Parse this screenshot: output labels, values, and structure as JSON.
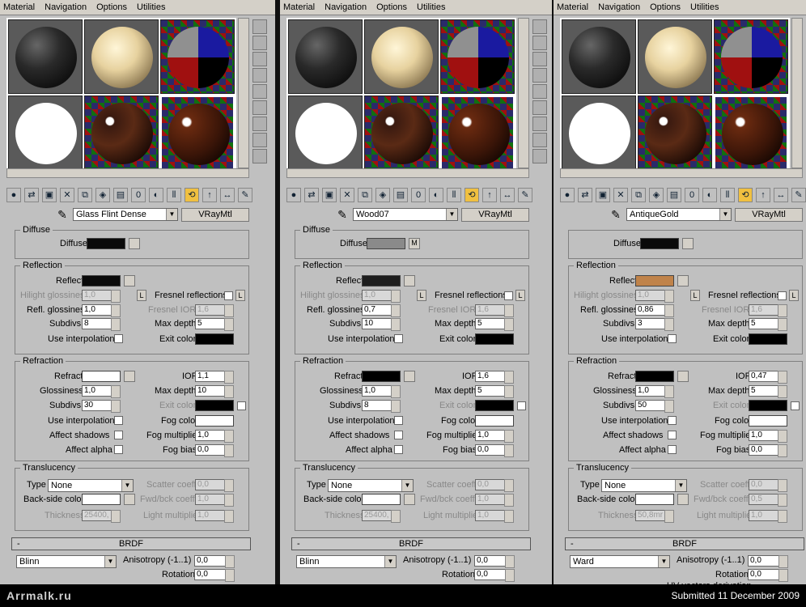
{
  "menu": [
    "Material",
    "Navigation",
    "Options",
    "Utilities"
  ],
  "sidebar_icons": [
    "sphere-icon",
    "backlight-icon",
    "checker-icon",
    "box-icon",
    "colorcheck-icon",
    "vidcolor-icon",
    "options-icon",
    "selectbymat-icon",
    "navigator-icon"
  ],
  "panels": [
    {
      "material_name": "Glass Flint Dense",
      "material_type": "VRayMtl",
      "diffuse": {
        "group": "Diffuse",
        "label": "Diffuse",
        "color": "#0a0a0a",
        "map_btn": ""
      },
      "reflection": {
        "group": "Reflection",
        "reflect_label": "Reflect",
        "reflect_color": "#0a0a0a",
        "hilight_label": "Hilight glossiness",
        "hilight": "1,0",
        "refl_gloss_label": "Refl. glossiness",
        "refl_gloss": "1,0",
        "subdivs_label": "Subdivs",
        "subdivs": "8",
        "use_interp": "Use interpolation",
        "fresnel_label": "Fresnel reflections",
        "fresnel_ior_label": "Fresnel IOR",
        "fresnel_ior": "1,6",
        "max_depth_label": "Max depth",
        "max_depth": "5",
        "exit_label": "Exit color",
        "exit_color": "#000000",
        "lock": "L"
      },
      "refraction": {
        "group": "Refraction",
        "refract_label": "Refract",
        "refract_color": "#ffffff",
        "gloss_label": "Glossiness",
        "gloss": "1,0",
        "subdivs_label": "Subdivs",
        "subdivs": "30",
        "use_interp": "Use interpolation",
        "affect_shadows": "Affect shadows",
        "affect_alpha": "Affect alpha",
        "ior_label": "IOR",
        "ior": "1,1",
        "max_depth_label": "Max depth",
        "max_depth": "10",
        "exit_label": "Exit color",
        "exit_color": "#000000",
        "fog_color_label": "Fog color",
        "fog_color": "#ffffff",
        "fog_mult_label": "Fog multiplier",
        "fog_mult": "1,0",
        "fog_bias_label": "Fog bias",
        "fog_bias": "0,0"
      },
      "translucency": {
        "group": "Translucency",
        "type_label": "Type",
        "type": "None",
        "back_label": "Back-side color",
        "back_color": "#ffffff",
        "thick_label": "Thickness",
        "thickness": "25400,",
        "scatter_label": "Scatter coeff",
        "scatter": "0,0",
        "fwd_label": "Fwd/bck coeff",
        "fwd": "1,0",
        "light_label": "Light multiplier",
        "light": "1,0"
      },
      "brdf": {
        "title": "BRDF",
        "minus": "-",
        "type": "Blinn",
        "aniso_label": "Anisotropy (-1..1)",
        "aniso": "0,0",
        "rot_label": "Rotation",
        "rot": "0,0"
      }
    },
    {
      "material_name": "Wood07",
      "material_type": "VRayMtl",
      "diffuse": {
        "group": "Diffuse",
        "label": "Diffuse",
        "color": "#8a8a8a",
        "map_btn": "M"
      },
      "reflection": {
        "group": "Reflection",
        "reflect_label": "Reflect",
        "reflect_color": "#1e1e1e",
        "hilight_label": "Hilight glossiness",
        "hilight": "1,0",
        "refl_gloss_label": "Refl. glossiness",
        "refl_gloss": "0,7",
        "subdivs_label": "Subdivs",
        "subdivs": "10",
        "use_interp": "Use interpolation",
        "fresnel_label": "Fresnel reflections",
        "fresnel_ior_label": "Fresnel IOR",
        "fresnel_ior": "1,6",
        "max_depth_label": "Max depth",
        "max_depth": "5",
        "exit_label": "Exit color",
        "exit_color": "#000000",
        "lock": "L"
      },
      "refraction": {
        "group": "Refraction",
        "refract_label": "Refract",
        "refract_color": "#000000",
        "gloss_label": "Glossiness",
        "gloss": "1,0",
        "subdivs_label": "Subdivs",
        "subdivs": "8",
        "use_interp": "Use interpolation",
        "affect_shadows": "Affect shadows",
        "affect_alpha": "Affect alpha",
        "ior_label": "IOR",
        "ior": "1,6",
        "max_depth_label": "Max depth",
        "max_depth": "5",
        "exit_label": "Exit color",
        "exit_color": "#000000",
        "fog_color_label": "Fog color",
        "fog_color": "#ffffff",
        "fog_mult_label": "Fog multiplier",
        "fog_mult": "1,0",
        "fog_bias_label": "Fog bias",
        "fog_bias": "0,0"
      },
      "translucency": {
        "group": "Translucency",
        "type_label": "Type",
        "type": "None",
        "back_label": "Back-side color",
        "back_color": "#ffffff",
        "thick_label": "Thickness",
        "thickness": "25400,",
        "scatter_label": "Scatter coeff",
        "scatter": "0,0",
        "fwd_label": "Fwd/bck coeff",
        "fwd": "1,0",
        "light_label": "Light multiplier",
        "light": "1,0"
      },
      "brdf": {
        "title": "BRDF",
        "minus": "-",
        "type": "Blinn",
        "aniso_label": "Anisotropy (-1..1)",
        "aniso": "0,0",
        "rot_label": "Rotation",
        "rot": "0,0"
      }
    },
    {
      "material_name": "AntiqueGold",
      "material_type": "VRayMtl",
      "diffuse": {
        "group": "",
        "label": "Diffuse",
        "color": "#0a0a0a",
        "map_btn": ""
      },
      "reflection": {
        "group": "Reflection",
        "reflect_label": "Reflect",
        "reflect_color": "#c0834a",
        "hilight_label": "Hilight glossiness",
        "hilight": "1,0",
        "refl_gloss_label": "Refl. glossiness",
        "refl_gloss": "0,86",
        "subdivs_label": "Subdivs",
        "subdivs": "3",
        "use_interp": "Use interpolation",
        "fresnel_label": "Fresnel reflections",
        "fresnel_ior_label": "Fresnel IOR",
        "fresnel_ior": "1,6",
        "max_depth_label": "Max depth",
        "max_depth": "5",
        "exit_label": "Exit color",
        "exit_color": "#000000",
        "lock": "L"
      },
      "refraction": {
        "group": "Refraction",
        "refract_label": "Refract",
        "refract_color": "#000000",
        "gloss_label": "Glossiness",
        "gloss": "1,0",
        "subdivs_label": "Subdivs",
        "subdivs": "50",
        "use_interp": "Use interpolation",
        "affect_shadows": "Affect shadows",
        "affect_alpha": "Affect alpha",
        "ior_label": "IOR",
        "ior": "0,47",
        "max_depth_label": "Max depth",
        "max_depth": "5",
        "exit_label": "Exit color",
        "exit_color": "#000000",
        "fog_color_label": "Fog color",
        "fog_color": "#ffffff",
        "fog_mult_label": "Fog multiplier",
        "fog_mult": "1,0",
        "fog_bias_label": "Fog bias",
        "fog_bias": "0,0"
      },
      "translucency": {
        "group": "Translucency",
        "type_label": "Type",
        "type": "None",
        "back_label": "Back-side color",
        "back_color": "#ffffff",
        "thick_label": "Thickness",
        "thickness": "50,8mr",
        "scatter_label": "Scatter coeff",
        "scatter": "0,0",
        "fwd_label": "Fwd/bck coeff",
        "fwd": "0,5",
        "light_label": "Light multiplier",
        "light": "1,0"
      },
      "brdf": {
        "title": "BRDF",
        "minus": "-",
        "type": "Ward",
        "aniso_label": "Anisotropy (-1..1)",
        "aniso": "0,0",
        "rot_label": "Rotation",
        "rot": "0,0",
        "uv_label": "UV vectors derivation"
      }
    }
  ],
  "footer": {
    "logo": "Arrmalk.ru",
    "submitted": "Submitted 11 December 2009"
  }
}
